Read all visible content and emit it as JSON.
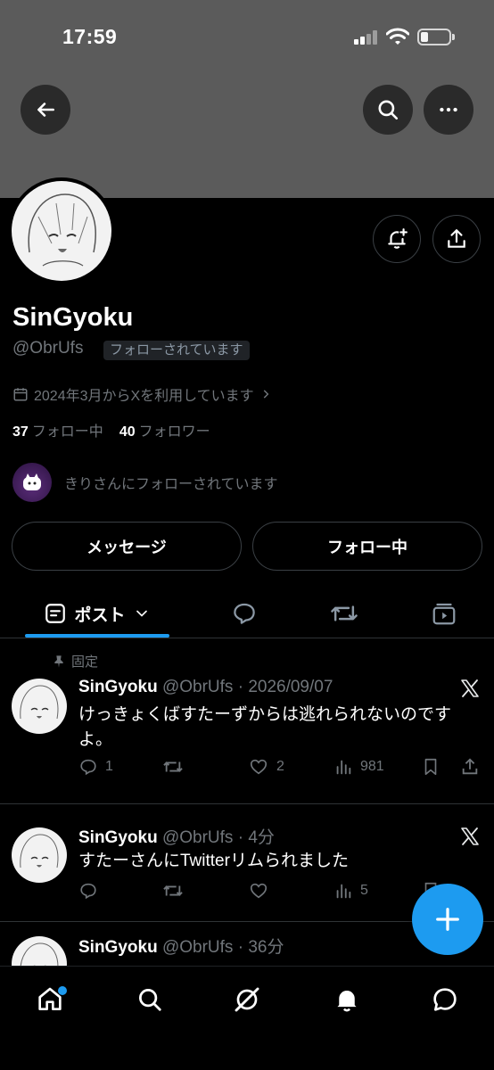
{
  "status_bar": {
    "time": "17:59"
  },
  "header": {
    "back_icon": "arrow-left-icon",
    "search_icon": "search-icon",
    "more_icon": "more-icon"
  },
  "profile": {
    "display_name": "SinGyoku",
    "handle": "@ObrUfs",
    "follows_you_badge": "フォローされています",
    "joined": "2024年3月からXを利用しています",
    "following_count": "37",
    "following_label": "フォロー中",
    "followers_count": "40",
    "followers_label": "フォロワー",
    "followed_by_text": "きりさんにフォローされています",
    "message_button": "メッセージ",
    "following_button": "フォロー中"
  },
  "tabs": {
    "posts_label": "ポスト"
  },
  "pinned_label": "固定",
  "tweets": [
    {
      "name": "SinGyoku",
      "meta": "@ObrUfs · 2026/09/07",
      "text": "けっきょくばすたーずからは逃れられないのですよ。",
      "replies": "1",
      "likes": "2",
      "views": "981"
    },
    {
      "name": "SinGyoku",
      "meta": "@ObrUfs · 4分",
      "text": "すたーさんにTwitterリムられました",
      "replies": "",
      "likes": "",
      "views": "5"
    },
    {
      "name": "SinGyoku",
      "meta": "@ObrUfs · 36分",
      "text": "",
      "replies": "",
      "likes": "",
      "views": ""
    }
  ],
  "colors": {
    "accent": "#1d9bf0",
    "banner": "#5b5b5b",
    "muted": "#71767b"
  }
}
